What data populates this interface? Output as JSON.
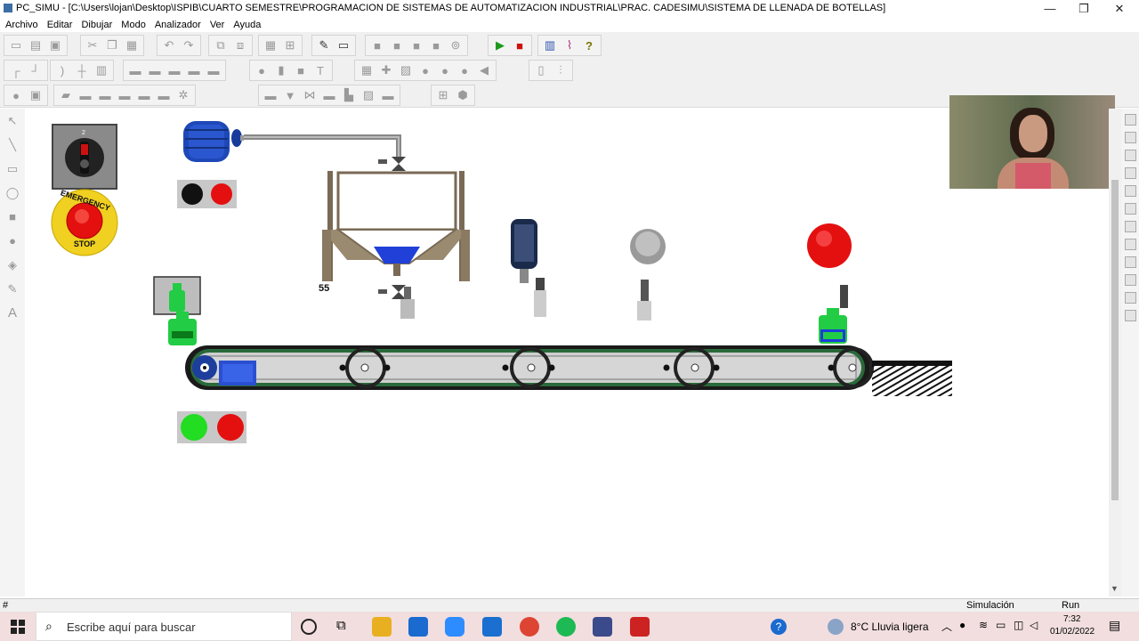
{
  "window": {
    "title": "PC_SIMU - [C:\\Users\\lojan\\Desktop\\ISPIB\\CUARTO SEMESTRE\\PROGRAMACION DE SISTEMAS DE AUTOMATIZACION INDUSTRIAL\\PRAC. CADESIMU\\SISTEMA DE LLENADA DE BOTELLAS]",
    "minimize": "—",
    "restore": "❐",
    "close": "✕"
  },
  "menu": [
    "Archivo",
    "Editar",
    "Dibujar",
    "Modo",
    "Analizador",
    "Ver",
    "Ayuda"
  ],
  "canvas": {
    "selector_label": "2",
    "emergency_text_top": "EMERGENCY",
    "emergency_text_bottom": "STOP",
    "tank_level_value": "55"
  },
  "status": {
    "left": "#",
    "mode": "Simulación",
    "state": "Run"
  },
  "taskbar": {
    "search_placeholder": "Escribe aquí para buscar",
    "weather": "8°C  Lluvia ligera",
    "time": "7:32",
    "date": "01/02/2022"
  },
  "colors": {
    "lamp_green": "#22dd22",
    "lamp_red": "#ee1111",
    "motor_blue": "#1a3fa8",
    "bottle_green": "#22cc44",
    "taskbar_bg": "#f2dede"
  }
}
